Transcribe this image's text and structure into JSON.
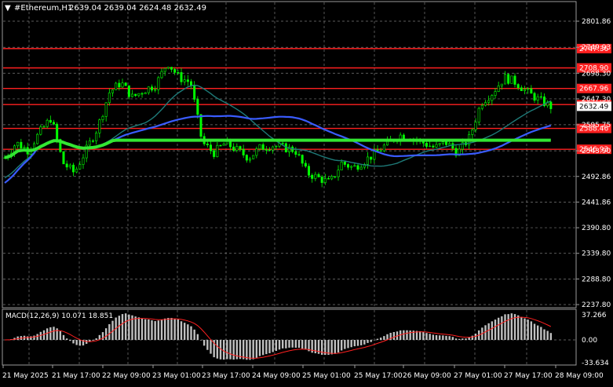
{
  "header": {
    "menu_icon": "triangle-down-icon",
    "symbol": "#Ethereum,H1",
    "ohlc": "2639.04 2639.04 2624.48 2632.49"
  },
  "price_axis": [
    "2801.86",
    "2749.93",
    "2698.30",
    "2647.30",
    "2595.75",
    "2543.90",
    "2492.86",
    "2441.86",
    "2390.80",
    "2339.80",
    "2288.80",
    "2237.80"
  ],
  "levels": [
    {
      "label": "2747.36",
      "value": 2747.36,
      "color": "#ff2020",
      "tag_bg": "#ff2020"
    },
    {
      "label": "2708.90",
      "value": 2708.9,
      "color": "#ff2020",
      "tag_bg": "#ff2020"
    },
    {
      "label": "2667.96",
      "value": 2667.96,
      "color": "#ff2020",
      "tag_bg": "#ff2020"
    },
    {
      "label": "2635.93",
      "value": 2635.93,
      "color": "#ff2020",
      "tag_bg": "#ff2020"
    },
    {
      "label": "2588.46",
      "value": 2588.46,
      "color": "#ff2020",
      "tag_bg": "#ff2020"
    },
    {
      "label": "2546.93",
      "value": 2546.93,
      "color": "#ff2020",
      "tag_bg": "#ff2020"
    }
  ],
  "current_price": {
    "label": "2632.49",
    "value": 2632.49
  },
  "macd": {
    "title": "MACD(12,26,9) 10.071 18.851",
    "axis": [
      "37.266",
      "0.00",
      "-33.634"
    ]
  },
  "time_axis": [
    "21 May 2025",
    "21 May 17:00",
    "22 May 09:00",
    "23 May 01:00",
    "23 May 17:00",
    "24 May 09:00",
    "25 May 01:00",
    "25 May 17:00",
    "26 May 09:00",
    "27 May 01:00",
    "27 May 17:00",
    "28 May 09:00"
  ],
  "colors": {
    "background": "#000000",
    "candles": "#00ff00",
    "ma_fast": "#1e7a78",
    "ma_mid": "#3a5cff",
    "ma_slow": "#32e632",
    "level_lines": "#ff2020",
    "grid": "#7a7a7a",
    "macd_hist": "#c0c0c0",
    "macd_signal": "#ff2020"
  },
  "chart_data": {
    "type": "candlestick",
    "symbol": "#Ethereum",
    "timeframe": "H1",
    "ylim": [
      2237.8,
      2801.86
    ],
    "approx_close_path": [
      2530,
      2560,
      2545,
      2580,
      2610,
      2520,
      2500,
      2545,
      2590,
      2660,
      2680,
      2650,
      2665,
      2675,
      2720,
      2690,
      2680,
      2560,
      2540,
      2560,
      2545,
      2530,
      2550,
      2555,
      2550,
      2545,
      2500,
      2490,
      2480,
      2520,
      2510,
      2525,
      2540,
      2560,
      2575,
      2570,
      2560,
      2550,
      2560,
      2540,
      2570,
      2640,
      2660,
      2690,
      2680,
      2660,
      2645,
      2632
    ],
    "macd_range": [
      -33.634,
      37.266
    ]
  }
}
